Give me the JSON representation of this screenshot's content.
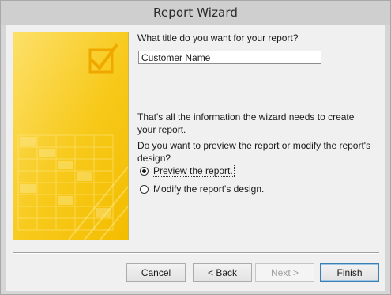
{
  "window": {
    "title": "Report Wizard"
  },
  "form": {
    "question": "What title do you want for your report?",
    "title_value": "Customer Name",
    "info": "That's all the information the wizard needs to create your report.",
    "prompt": "Do you want to preview the report or modify the report's design?"
  },
  "options": [
    {
      "label": "Preview the report.",
      "selected": true
    },
    {
      "label": "Modify the report's design.",
      "selected": false
    }
  ],
  "buttons": {
    "cancel": "Cancel",
    "back": "< Back",
    "next": "Next >",
    "finish": "Finish"
  },
  "colors": {
    "art_yellow": "#f5c400",
    "art_light": "#fde477",
    "window_bg": "#f0f0f0"
  },
  "icons": {
    "art": "checkmark-box-icon"
  }
}
